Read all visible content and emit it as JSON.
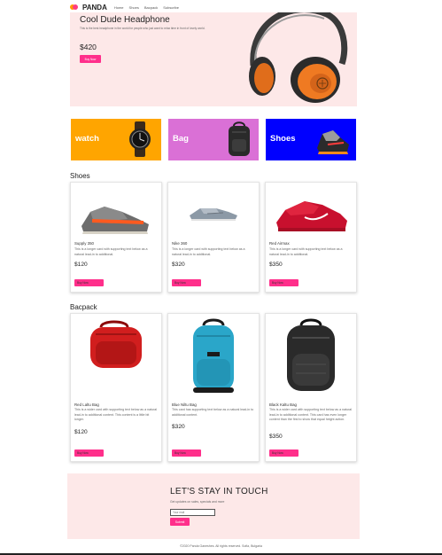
{
  "nav": {
    "brand": "PANDA",
    "links": [
      "Home",
      "Shoes",
      "Bacpack",
      "Subscribe"
    ]
  },
  "hero": {
    "title": "Cool Dude Headphone",
    "description": "This is the best headphone in the world for people who just want to relax time in front of lovely world.",
    "price": "$420",
    "button": "Buy Now"
  },
  "categories": [
    {
      "label": "watch",
      "color": "#ffa500",
      "icon": "watch-icon"
    },
    {
      "label": "Bag",
      "color": "#da70d6",
      "icon": "backpack-icon"
    },
    {
      "label": "Shoes",
      "color": "#0000ff",
      "icon": "sneaker-icon"
    }
  ],
  "shoes": {
    "title": "Shoes",
    "cards": [
      {
        "name": "Supply 350",
        "text": "This is a longer card with supporting text below as a natural lead-in to additional.",
        "price": "$120",
        "button": "Buy Now"
      },
      {
        "name": "Nike 360",
        "text": "This is a longer card with supporting text below as a natural lead-in to additional.",
        "price": "$320",
        "button": "Buy Now"
      },
      {
        "name": "Red Airmax",
        "text": "This is a longer card with supporting text below as a natural lead-in to additional.",
        "price": "$350",
        "button": "Buy Now"
      }
    ]
  },
  "backpack": {
    "title": "Bacpack",
    "cards": [
      {
        "name": "Red Laltu Bag",
        "text": "This is a wider card with supporting text below as a natural lead-in to additional content. This content is a little bit longer.",
        "price": "$120",
        "button": "Buy Now"
      },
      {
        "name": "Blue Niltu Bag",
        "text": "This card has supporting text below as a natural lead-in to additional content.",
        "price": "$320",
        "button": "Buy Now"
      },
      {
        "name": "Black Kaltu Bag",
        "text": "This is a wider card with supporting text below as a natural lead-in to additional content. This card has even longer content than the first to show that equal height action.",
        "price": "$350",
        "button": "Buy Now"
      }
    ]
  },
  "newsletter": {
    "title": "LET'S STAY IN TOUCH",
    "subtitle": "Get updates on sales, specials and more",
    "placeholder": "Your mail",
    "button": "Submit"
  },
  "footer": "©2020 Panda Ganeshes. All rights reserved. Sofia, Bulgaria"
}
